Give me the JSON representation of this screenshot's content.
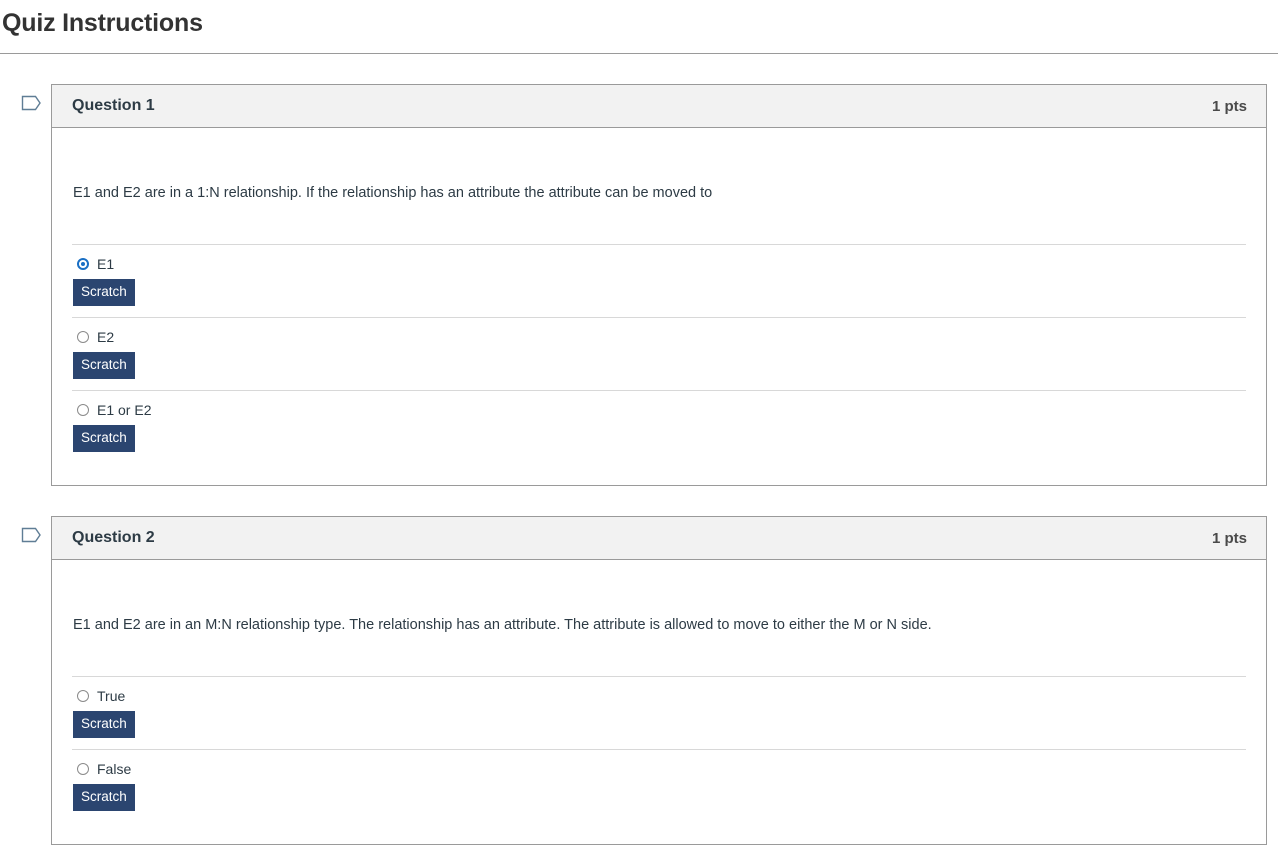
{
  "page": {
    "title": "Quiz Instructions"
  },
  "icons": {
    "flag": "flag-outline-icon"
  },
  "colors": {
    "scratch_button_bg": "#2b4570",
    "selected_radio": "#1a6fc4",
    "header_bg": "#f2f2f2",
    "border": "#9a9a9a",
    "flag_outline": "#5f7d95"
  },
  "questions": [
    {
      "name": "Question 1",
      "points": "1 pts",
      "text": "E1 and E2 are in a 1:N relationship.  If the relationship has an attribute the attribute can be moved to",
      "answers": [
        {
          "label": "E1",
          "selected": true,
          "scratch_label": "Scratch"
        },
        {
          "label": "E2",
          "selected": false,
          "scratch_label": "Scratch"
        },
        {
          "label": "E1 or E2",
          "selected": false,
          "scratch_label": "Scratch"
        }
      ]
    },
    {
      "name": "Question 2",
      "points": "1 pts",
      "text": "E1 and E2 are in an M:N relationship type.  The relationship has an attribute.  The attribute is allowed to move to either the M or N side.",
      "answers": [
        {
          "label": "True",
          "selected": false,
          "scratch_label": "Scratch"
        },
        {
          "label": "False",
          "selected": false,
          "scratch_label": "Scratch"
        }
      ]
    }
  ]
}
